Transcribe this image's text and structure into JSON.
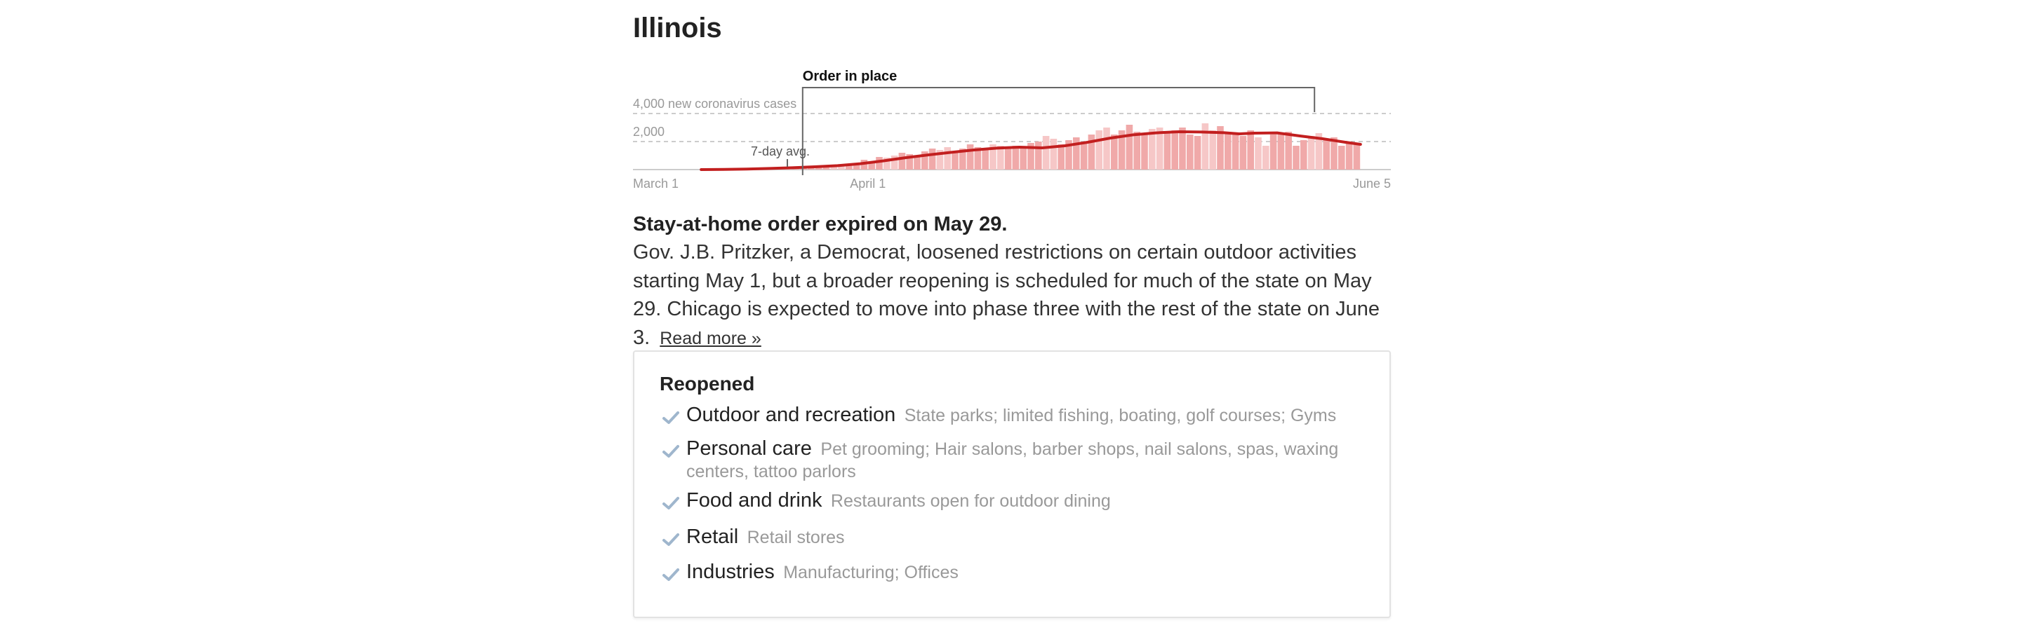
{
  "state": {
    "name": "Illinois"
  },
  "chart_data": {
    "type": "bar",
    "title": "",
    "xlabel": "",
    "ylabel": "new coronavirus cases",
    "ylim": [
      0,
      4000
    ],
    "y_ticks": [
      {
        "value": 4000,
        "label": "4,000 new coronavirus cases"
      },
      {
        "value": 2000,
        "label": "2,000"
      }
    ],
    "x_start": "March 1",
    "x_end": "June 5",
    "x_ticks": [
      {
        "day": 0,
        "label": "March 1"
      },
      {
        "day": 31,
        "label": "April 1"
      },
      {
        "day": 96,
        "label": "June 5"
      }
    ],
    "grid": true,
    "order_annotation": {
      "label": "Order in place",
      "start_day": 21,
      "end_day": 89
    },
    "avg_annotation": {
      "label": "7-day avg.",
      "day": 20
    },
    "colors": {
      "bars": "#f0a9a9",
      "bars_light": "#f6c7c7",
      "avg_line": "#c21f1f",
      "grid": "#cccccc",
      "axis": "#cccccc"
    },
    "series": [
      {
        "name": "Daily new cases",
        "kind": "bar",
        "x": [
          0,
          1,
          2,
          3,
          4,
          5,
          6,
          7,
          8,
          9,
          10,
          11,
          12,
          13,
          14,
          15,
          16,
          17,
          18,
          19,
          20,
          21,
          22,
          23,
          24,
          25,
          26,
          27,
          28,
          29,
          30,
          31,
          32,
          33,
          34,
          35,
          36,
          37,
          38,
          39,
          40,
          41,
          42,
          43,
          44,
          45,
          46,
          47,
          48,
          49,
          50,
          51,
          52,
          53,
          54,
          55,
          56,
          57,
          58,
          59,
          60,
          61,
          62,
          63,
          64,
          65,
          66,
          67,
          68,
          69,
          70,
          71,
          72,
          73,
          74,
          75,
          76,
          77,
          78,
          79,
          80,
          81,
          82,
          83,
          84,
          85,
          86,
          87,
          88,
          89,
          90,
          91,
          92,
          93,
          94,
          95
        ],
        "values": [
          0,
          0,
          0,
          0,
          0,
          0,
          0,
          0,
          0,
          2,
          2,
          4,
          6,
          10,
          12,
          20,
          30,
          50,
          60,
          70,
          100,
          120,
          150,
          180,
          200,
          260,
          300,
          250,
          350,
          450,
          700,
          550,
          900,
          850,
          1000,
          1200,
          1100,
          1000,
          1300,
          1500,
          1400,
          1600,
          1200,
          1500,
          1800,
          1600,
          1500,
          1800,
          1700,
          1500,
          1700,
          1600,
          1900,
          2000,
          2400,
          2200,
          1800,
          2100,
          2300,
          2000,
          2500,
          2800,
          3000,
          2500,
          2800,
          3200,
          2700,
          2600,
          2900,
          3000,
          2600,
          2800,
          3000,
          2500,
          2400,
          3300,
          2800,
          3100,
          2700,
          2500,
          2400,
          2800,
          2300,
          1700,
          2500,
          2600,
          2700,
          1700,
          2100,
          2400,
          2600,
          2200,
          2300,
          1700,
          2000,
          1900
        ]
      },
      {
        "name": "7-day avg.",
        "kind": "line",
        "x": [
          9,
          12,
          15,
          18,
          21,
          24,
          27,
          30,
          33,
          36,
          39,
          42,
          45,
          48,
          51,
          54,
          57,
          60,
          63,
          66,
          69,
          72,
          75,
          78,
          80,
          82,
          85,
          88,
          91,
          94,
          96
        ],
        "values": [
          0,
          10,
          40,
          80,
          130,
          200,
          280,
          420,
          620,
          850,
          1050,
          1230,
          1400,
          1530,
          1600,
          1550,
          1700,
          1950,
          2250,
          2480,
          2620,
          2700,
          2680,
          2630,
          2550,
          2600,
          2620,
          2400,
          2200,
          1950,
          1800
        ]
      }
    ]
  },
  "summary": {
    "headline": "Stay-at-home order expired on May 29.",
    "body": "Gov. J.B. Pritzker, a Democrat, loosened restrictions on certain outdoor activities starting May 1, but a broader reopening is scheduled for much of the state on May 29. Chicago is expected to move into phase three with the rest of the state on June 3.",
    "read_more": "Read more »"
  },
  "reopened": {
    "heading": "Reopened",
    "check_color": "#9fb6cd",
    "items": [
      {
        "name": "Outdoor and recreation",
        "detail": "State parks; limited fishing, boating, golf courses; Gyms",
        "icon": "check-icon"
      },
      {
        "name": "Personal care",
        "detail": "Pet grooming; Hair salons, barber shops, nail salons, spas, waxing centers, tattoo parlors",
        "icon": "check-icon"
      },
      {
        "name": "Food and drink",
        "detail": "Restaurants open for outdoor dining",
        "icon": "check-icon"
      },
      {
        "name": "Retail",
        "detail": "Retail stores",
        "icon": "check-icon"
      },
      {
        "name": "Industries",
        "detail": "Manufacturing; Offices",
        "icon": "check-icon"
      }
    ]
  }
}
